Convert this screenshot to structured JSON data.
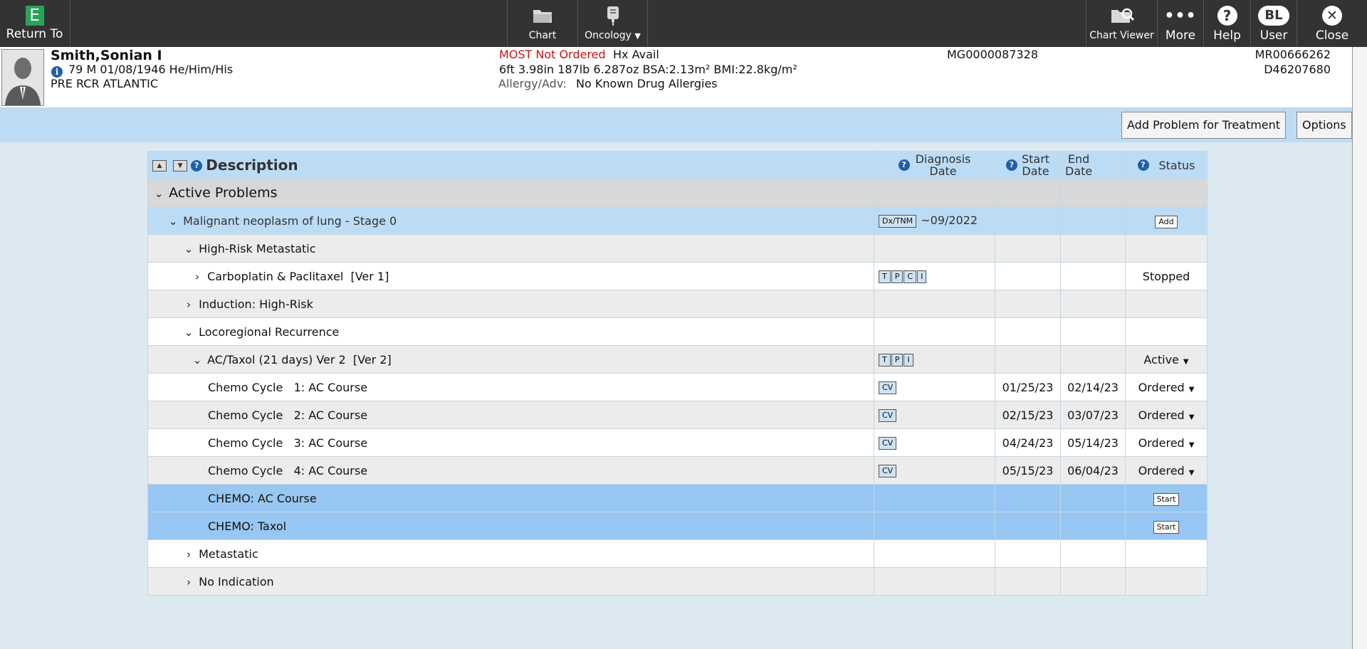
{
  "topbar": {
    "return_label": "Return To",
    "return_logo": "E",
    "chart_label": "Chart",
    "oncology_label": "Oncology",
    "chart_viewer_label": "Chart Viewer",
    "more_label": "More",
    "help_label": "Help",
    "user_initials": "BL",
    "user_label": "User",
    "close_label": "Close"
  },
  "patient": {
    "name": "Smith,Sonian I",
    "demographics": "79  M  01/08/1946  He/Him/His",
    "location": "PRE RCR  ATLANTIC",
    "most": "MOST Not Ordered",
    "hx": "Hx Avail",
    "measurements": "6ft 3.98in  187lb 6.287oz  BSA:2.13m² BMI:22.8kg/m²",
    "allergy_label": "Allergy/Adv:",
    "allergy_value": "No Known Drug Allergies",
    "mg": "MG0000087328",
    "mr": "MR00666262",
    "d_number": "D46207680"
  },
  "actions": {
    "add_problem": "Add Problem for Treatment",
    "options": "Options"
  },
  "grid": {
    "headers": {
      "description": "Description",
      "diagnosis_date": "Diagnosis\nDate",
      "start_date": "Start\nDate",
      "end_date": "End\nDate",
      "status": "Status"
    },
    "rows": [
      {
        "level": 0,
        "chev": "down",
        "text": "Active Problems",
        "tags": [],
        "date": "",
        "start": "",
        "end": "",
        "status": "",
        "sbtn": "",
        "dd": false,
        "style": "gd"
      },
      {
        "level": 1,
        "chev": "down",
        "text": "Malignant neoplasm of lung - Stage 0",
        "tags": [
          "Dx/TNM"
        ],
        "date": "~09/2022",
        "start": "",
        "end": "",
        "status": "",
        "sbtn": "Add",
        "dd": false,
        "style": "lb"
      },
      {
        "level": 2,
        "chev": "down",
        "text": "High-Risk Metastatic",
        "tags": [],
        "date": "",
        "start": "",
        "end": "",
        "status": "",
        "sbtn": "",
        "dd": false,
        "style": "g"
      },
      {
        "level": 3,
        "chev": "right",
        "text": "Carboplatin & Paclitaxel  [Ver 1]",
        "tags": [
          "T",
          "P",
          "C",
          "I"
        ],
        "date": "",
        "start": "",
        "end": "",
        "status": "Stopped",
        "sbtn": "",
        "dd": false,
        "style": "w"
      },
      {
        "level": 2,
        "chev": "right",
        "text": "Induction: High-Risk",
        "tags": [],
        "date": "",
        "start": "",
        "end": "",
        "status": "",
        "sbtn": "",
        "dd": false,
        "style": "g"
      },
      {
        "level": 2,
        "chev": "down",
        "text": "Locoregional Recurrence",
        "tags": [],
        "date": "",
        "start": "",
        "end": "",
        "status": "",
        "sbtn": "",
        "dd": false,
        "style": "w"
      },
      {
        "level": 3,
        "chev": "down",
        "text": "AC/Taxol (21 days) Ver 2  [Ver 2]",
        "tags": [
          "T",
          "P",
          "I"
        ],
        "date": "",
        "start": "",
        "end": "",
        "status": "Active",
        "sbtn": "",
        "dd": true,
        "style": "g"
      },
      {
        "level": 4,
        "chev": "",
        "text": "Chemo Cycle   1: AC Course",
        "tags": [
          "CV"
        ],
        "date": "",
        "start": "01/25/23",
        "end": "02/14/23",
        "status": "Ordered",
        "sbtn": "",
        "dd": true,
        "style": "w"
      },
      {
        "level": 4,
        "chev": "",
        "text": "Chemo Cycle   2: AC Course",
        "tags": [
          "CV"
        ],
        "date": "",
        "start": "02/15/23",
        "end": "03/07/23",
        "status": "Ordered",
        "sbtn": "",
        "dd": true,
        "style": "g"
      },
      {
        "level": 4,
        "chev": "",
        "text": "Chemo Cycle   3: AC Course",
        "tags": [
          "CV"
        ],
        "date": "",
        "start": "04/24/23",
        "end": "05/14/23",
        "status": "Ordered",
        "sbtn": "",
        "dd": true,
        "style": "w"
      },
      {
        "level": 4,
        "chev": "",
        "text": "Chemo Cycle   4: AC Course",
        "tags": [
          "CV"
        ],
        "date": "",
        "start": "05/15/23",
        "end": "06/04/23",
        "status": "Ordered",
        "sbtn": "",
        "dd": true,
        "style": "g"
      },
      {
        "level": 4,
        "chev": "",
        "text": "CHEMO: AC Course",
        "tags": [],
        "date": "",
        "start": "",
        "end": "",
        "status": "",
        "sbtn": "Start",
        "dd": false,
        "style": "b"
      },
      {
        "level": 4,
        "chev": "",
        "text": "CHEMO: Taxol",
        "tags": [],
        "date": "",
        "start": "",
        "end": "",
        "status": "",
        "sbtn": "Start",
        "dd": false,
        "style": "b"
      },
      {
        "level": 2,
        "chev": "right",
        "text": "Metastatic",
        "tags": [],
        "date": "",
        "start": "",
        "end": "",
        "status": "",
        "sbtn": "",
        "dd": false,
        "style": "w"
      },
      {
        "level": 2,
        "chev": "right",
        "text": "No Indication",
        "tags": [],
        "date": "",
        "start": "",
        "end": "",
        "status": "",
        "sbtn": "",
        "dd": false,
        "style": "g"
      }
    ]
  },
  "colors": {
    "topbar": "#333333",
    "logo": "#2aa35a",
    "header": "#bcdcf6",
    "selected": "#97c7f2",
    "most_red": "#cc1111"
  },
  "icons": {
    "chart": "folder-icon",
    "oncology": "iv-bag-icon",
    "chart_viewer": "folder-search-icon",
    "more": "more-dots-icon",
    "help": "help-icon",
    "close": "close-icon",
    "info": "info-icon",
    "help_col": "help-icon"
  }
}
